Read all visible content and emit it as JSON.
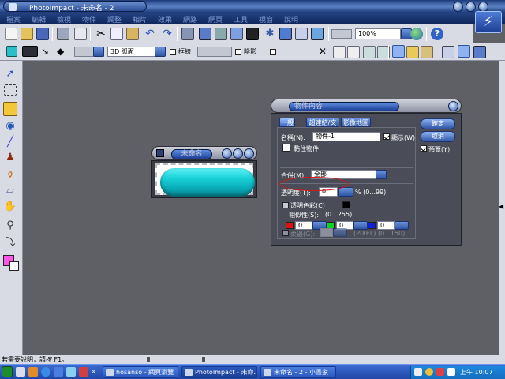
{
  "window": {
    "title": "PhotoImpact - 未命名 - 2"
  },
  "menu": [
    "檔案",
    "編輯",
    "檢視",
    "物件",
    "調整",
    "相片",
    "效果",
    "網路",
    "網頁",
    "工具",
    "視窗",
    "說明"
  ],
  "toolbar": {
    "zoom_value": "100%"
  },
  "attr_bar": {
    "mode_value": "3D 弧面",
    "border_label": "框線",
    "shadow_label": "陰影"
  },
  "doc_window": {
    "title": "未命名"
  },
  "dialog": {
    "title": "物件內容",
    "tabs": [
      "一般",
      "超連結/文字",
      "影像地圖"
    ],
    "name_label": "名稱(N):",
    "name_value": "物件-1",
    "show_label": "顯示(W)",
    "paste_label": "黏住物件",
    "group_label": "合併(M):",
    "group_value": "全部",
    "transparency_label": "透明度(T):",
    "transparency_value": "0",
    "transparency_range": "% (0...99)",
    "transparent_color_label": "透明色彩(C)",
    "similarity_label": "相似性(S):",
    "similarity_range": "(0...255)",
    "rgb_values": [
      "0",
      "0",
      "0"
    ],
    "soft_edge_label": "柔邊(G):",
    "soft_edge_range": "(PIXEL) (0...150)",
    "ok_label": "確定",
    "cancel_label": "取消",
    "preview_label": "預覽(Y)"
  },
  "status": {
    "help_text": "若需要說明，請按 F1。"
  },
  "taskbar": {
    "tasks": [
      "hosanso - 網頁瀏覽",
      "PhotoImpact - 未命...",
      "未命名 - 2 - 小畫家"
    ],
    "clock": "上午 10:07"
  },
  "colors": {
    "fg_swatch": "#ff55e8",
    "bg_swatch": "#ffffff",
    "pill": "#19d2d8",
    "accent": "#2f55a5"
  }
}
